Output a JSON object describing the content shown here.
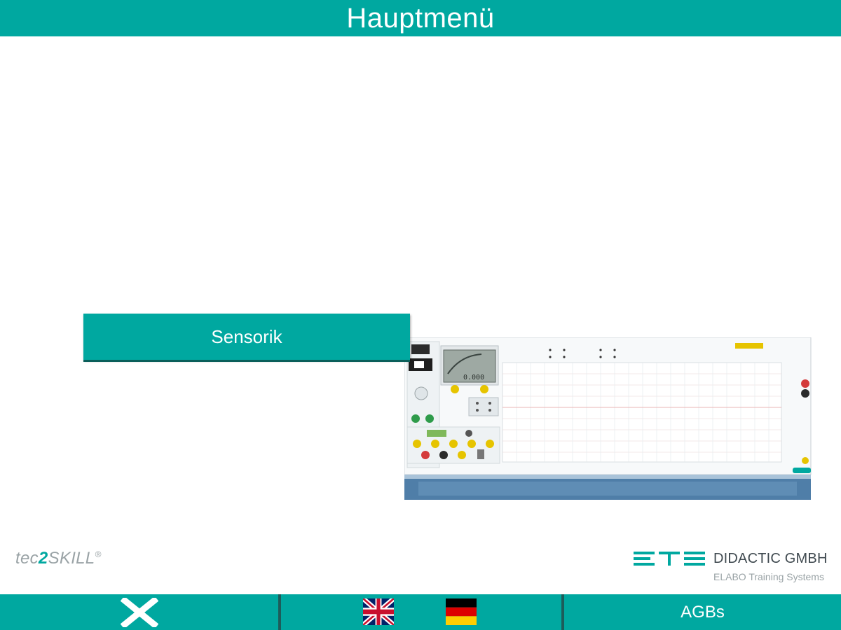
{
  "header": {
    "title": "Hauptmenü"
  },
  "menu": {
    "items": [
      {
        "label": "Sensorik"
      }
    ]
  },
  "branding": {
    "left_prefix": "tec",
    "left_digit": "2",
    "left_suffix": "SKILL",
    "left_mark": "®",
    "right_logo": "ETS",
    "right_name": "DIDACTIC GMBH",
    "right_tagline": "ELABO Training Systems"
  },
  "footer": {
    "close_icon": "close-icon",
    "languages": [
      {
        "name": "English",
        "icon": "uk-flag-icon"
      },
      {
        "name": "Deutsch",
        "icon": "german-flag-icon"
      }
    ],
    "agb_label": "AGBs"
  },
  "colors": {
    "accent": "#00a8a0",
    "footer_border": "#1d5c5a",
    "device_base": "#4f7ea8",
    "logo_text": "#404a50"
  }
}
